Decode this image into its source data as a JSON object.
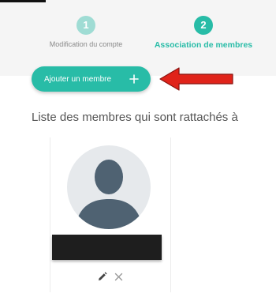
{
  "stepper": {
    "steps": [
      {
        "number": "1",
        "label": "Modification du compte",
        "state": "done"
      },
      {
        "number": "2",
        "label": "Association de membres",
        "state": "active"
      }
    ]
  },
  "actions": {
    "add_member_label": "Ajouter un membre",
    "add_member_icon": "plus-icon"
  },
  "annotation": {
    "icon": "red-arrow-pointing-left",
    "color": "#e0231a"
  },
  "members_section": {
    "title": "Liste des membres qui sont rattachés à"
  },
  "members": [
    {
      "avatar_icon": "default-user-avatar",
      "name": "",
      "name_redacted": true,
      "actions": [
        "pencil-icon",
        "close-icon"
      ]
    }
  ],
  "colors": {
    "accent": "#28bca7",
    "accent_light": "#9fdcd4",
    "muted_text": "#8a8a8a",
    "body_text": "#555555"
  }
}
